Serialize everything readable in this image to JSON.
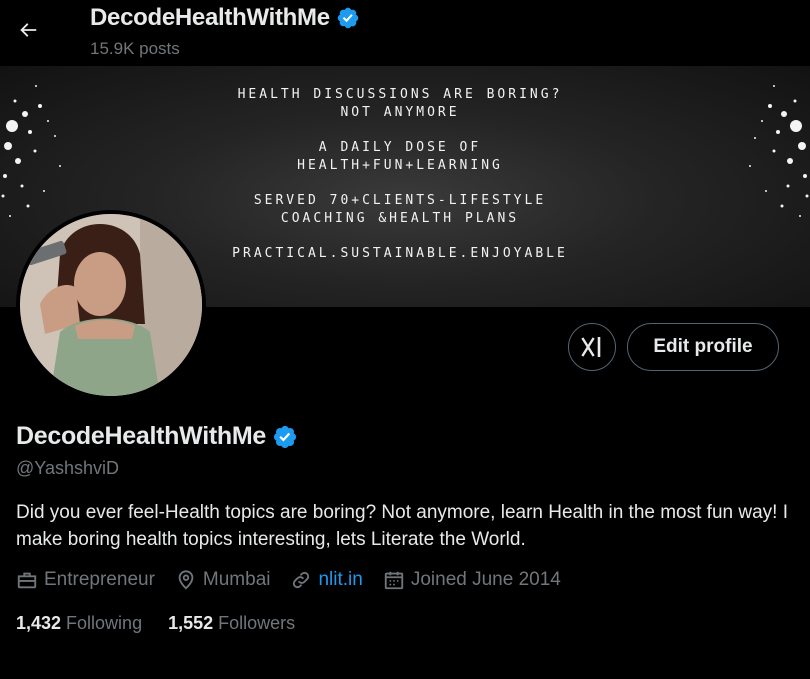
{
  "header": {
    "title": "DecodeHealthWithMe",
    "posts": "15.9K posts"
  },
  "banner": {
    "lines": [
      "HEALTH DISCUSSIONS ARE BORING?",
      "NOT ANYMORE",
      "A DAILY DOSE OF",
      "HEALTH+FUN+LEARNING",
      "SERVED 70+CLIENTS-LIFESTYLE",
      "COACHING &HEALTH PLANS",
      "PRACTICAL.SUSTAINABLE.ENJOYABLE"
    ]
  },
  "actions": {
    "edit_profile": "Edit profile"
  },
  "profile": {
    "name": "DecodeHealthWithMe",
    "handle": "@YashshviD",
    "bio": "Did you ever feel-Health topics are boring? Not anymore, learn Health in the most fun way! I make boring health topics interesting, lets Literate the World.",
    "category": "Entrepreneur",
    "location": "Mumbai",
    "website": "nlit.in",
    "joined": "Joined June 2014"
  },
  "stats": {
    "following_count": "1,432",
    "following_label": "Following",
    "followers_count": "1,552",
    "followers_label": "Followers"
  },
  "colors": {
    "accent": "#1d9bf0",
    "verified": "#1d9bf0",
    "muted": "#71767b",
    "text": "#e7e9ea",
    "background": "#000000"
  },
  "icons": {
    "back": "arrow-left-icon",
    "verified": "verified-badge-icon",
    "xai": "grok-icon",
    "category": "briefcase-icon",
    "location": "location-pin-icon",
    "website": "link-icon",
    "joined": "calendar-icon"
  }
}
